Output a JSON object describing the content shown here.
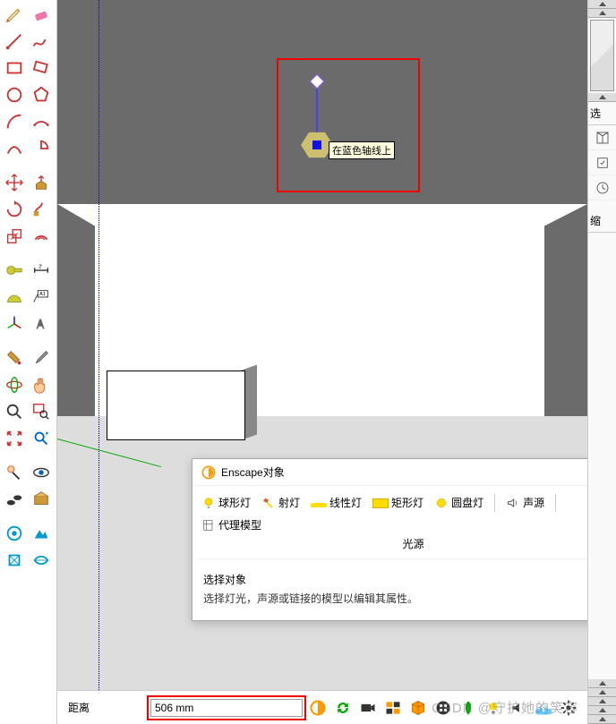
{
  "viewport": {
    "tooltip": "在蓝色轴线上"
  },
  "enscape_dialog": {
    "title": "Enscape对象",
    "close": "×",
    "items": {
      "sphere": "球形灯",
      "spot": "射灯",
      "line": "线性灯",
      "rect": "矩形灯",
      "disc": "圆盘灯",
      "sound": "声源",
      "proxy": "代理模型"
    },
    "sub": "光源",
    "body_heading": "选择对象",
    "body_desc": "选择灯光，声源或链接的模型以编辑其属性。"
  },
  "right_panel": {
    "label1": "选",
    "label2": "缩"
  },
  "status": {
    "label": "距离",
    "value": "506 mm"
  },
  "watermark": "CSDN @守护她的笑容"
}
